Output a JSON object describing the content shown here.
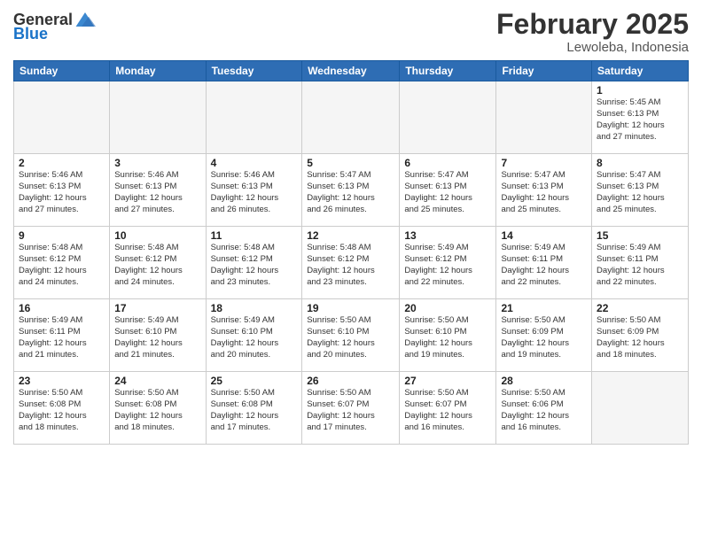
{
  "header": {
    "logo_general": "General",
    "logo_blue": "Blue",
    "month": "February 2025",
    "location": "Lewoleba, Indonesia"
  },
  "weekdays": [
    "Sunday",
    "Monday",
    "Tuesday",
    "Wednesday",
    "Thursday",
    "Friday",
    "Saturday"
  ],
  "weeks": [
    [
      {
        "day": "",
        "info": ""
      },
      {
        "day": "",
        "info": ""
      },
      {
        "day": "",
        "info": ""
      },
      {
        "day": "",
        "info": ""
      },
      {
        "day": "",
        "info": ""
      },
      {
        "day": "",
        "info": ""
      },
      {
        "day": "1",
        "info": "Sunrise: 5:45 AM\nSunset: 6:13 PM\nDaylight: 12 hours\nand 27 minutes."
      }
    ],
    [
      {
        "day": "2",
        "info": "Sunrise: 5:46 AM\nSunset: 6:13 PM\nDaylight: 12 hours\nand 27 minutes."
      },
      {
        "day": "3",
        "info": "Sunrise: 5:46 AM\nSunset: 6:13 PM\nDaylight: 12 hours\nand 27 minutes."
      },
      {
        "day": "4",
        "info": "Sunrise: 5:46 AM\nSunset: 6:13 PM\nDaylight: 12 hours\nand 26 minutes."
      },
      {
        "day": "5",
        "info": "Sunrise: 5:47 AM\nSunset: 6:13 PM\nDaylight: 12 hours\nand 26 minutes."
      },
      {
        "day": "6",
        "info": "Sunrise: 5:47 AM\nSunset: 6:13 PM\nDaylight: 12 hours\nand 25 minutes."
      },
      {
        "day": "7",
        "info": "Sunrise: 5:47 AM\nSunset: 6:13 PM\nDaylight: 12 hours\nand 25 minutes."
      },
      {
        "day": "8",
        "info": "Sunrise: 5:47 AM\nSunset: 6:13 PM\nDaylight: 12 hours\nand 25 minutes."
      }
    ],
    [
      {
        "day": "9",
        "info": "Sunrise: 5:48 AM\nSunset: 6:12 PM\nDaylight: 12 hours\nand 24 minutes."
      },
      {
        "day": "10",
        "info": "Sunrise: 5:48 AM\nSunset: 6:12 PM\nDaylight: 12 hours\nand 24 minutes."
      },
      {
        "day": "11",
        "info": "Sunrise: 5:48 AM\nSunset: 6:12 PM\nDaylight: 12 hours\nand 23 minutes."
      },
      {
        "day": "12",
        "info": "Sunrise: 5:48 AM\nSunset: 6:12 PM\nDaylight: 12 hours\nand 23 minutes."
      },
      {
        "day": "13",
        "info": "Sunrise: 5:49 AM\nSunset: 6:12 PM\nDaylight: 12 hours\nand 22 minutes."
      },
      {
        "day": "14",
        "info": "Sunrise: 5:49 AM\nSunset: 6:11 PM\nDaylight: 12 hours\nand 22 minutes."
      },
      {
        "day": "15",
        "info": "Sunrise: 5:49 AM\nSunset: 6:11 PM\nDaylight: 12 hours\nand 22 minutes."
      }
    ],
    [
      {
        "day": "16",
        "info": "Sunrise: 5:49 AM\nSunset: 6:11 PM\nDaylight: 12 hours\nand 21 minutes."
      },
      {
        "day": "17",
        "info": "Sunrise: 5:49 AM\nSunset: 6:10 PM\nDaylight: 12 hours\nand 21 minutes."
      },
      {
        "day": "18",
        "info": "Sunrise: 5:49 AM\nSunset: 6:10 PM\nDaylight: 12 hours\nand 20 minutes."
      },
      {
        "day": "19",
        "info": "Sunrise: 5:50 AM\nSunset: 6:10 PM\nDaylight: 12 hours\nand 20 minutes."
      },
      {
        "day": "20",
        "info": "Sunrise: 5:50 AM\nSunset: 6:10 PM\nDaylight: 12 hours\nand 19 minutes."
      },
      {
        "day": "21",
        "info": "Sunrise: 5:50 AM\nSunset: 6:09 PM\nDaylight: 12 hours\nand 19 minutes."
      },
      {
        "day": "22",
        "info": "Sunrise: 5:50 AM\nSunset: 6:09 PM\nDaylight: 12 hours\nand 18 minutes."
      }
    ],
    [
      {
        "day": "23",
        "info": "Sunrise: 5:50 AM\nSunset: 6:08 PM\nDaylight: 12 hours\nand 18 minutes."
      },
      {
        "day": "24",
        "info": "Sunrise: 5:50 AM\nSunset: 6:08 PM\nDaylight: 12 hours\nand 18 minutes."
      },
      {
        "day": "25",
        "info": "Sunrise: 5:50 AM\nSunset: 6:08 PM\nDaylight: 12 hours\nand 17 minutes."
      },
      {
        "day": "26",
        "info": "Sunrise: 5:50 AM\nSunset: 6:07 PM\nDaylight: 12 hours\nand 17 minutes."
      },
      {
        "day": "27",
        "info": "Sunrise: 5:50 AM\nSunset: 6:07 PM\nDaylight: 12 hours\nand 16 minutes."
      },
      {
        "day": "28",
        "info": "Sunrise: 5:50 AM\nSunset: 6:06 PM\nDaylight: 12 hours\nand 16 minutes."
      },
      {
        "day": "",
        "info": ""
      }
    ]
  ]
}
